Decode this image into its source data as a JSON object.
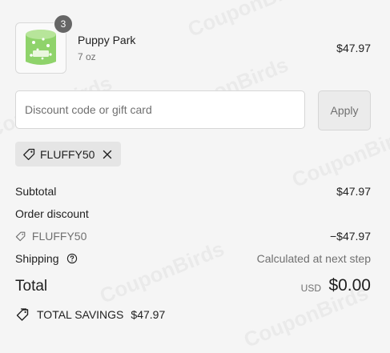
{
  "product": {
    "quantity": "3",
    "name": "Puppy Park",
    "variant": "7 oz",
    "price": "$47.97"
  },
  "discount": {
    "placeholder": "Discount code or gift card",
    "apply_label": "Apply",
    "applied_code": "FLUFFY50"
  },
  "summary": {
    "subtotal_label": "Subtotal",
    "subtotal_value": "$47.97",
    "order_discount_label": "Order discount",
    "discount_code": "FLUFFY50",
    "discount_value": "−$47.97",
    "shipping_label": "Shipping",
    "shipping_value": "Calculated at next step",
    "total_label": "Total",
    "currency": "USD",
    "total_value": "$0.00",
    "savings_label": "TOTAL SAVINGS",
    "savings_value": "$47.97"
  },
  "watermark": "CouponBirds"
}
